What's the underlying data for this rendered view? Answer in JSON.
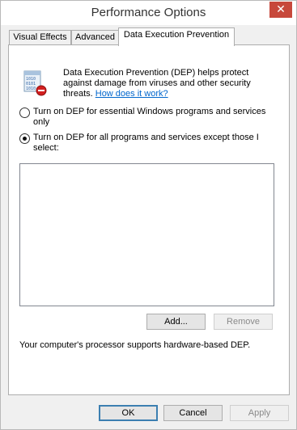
{
  "window": {
    "title": "Performance Options",
    "close_glyph": "✕"
  },
  "tabs": [
    {
      "label": "Visual Effects"
    },
    {
      "label": "Advanced"
    },
    {
      "label": "Data Execution Prevention"
    }
  ],
  "dep": {
    "icon": "dep-shield-icon",
    "description": "Data Execution Prevention (DEP) helps protect against damage from viruses and other security threats.",
    "link": "How does it work?",
    "option_essential": "Turn on DEP for essential Windows programs and services only",
    "option_all": "Turn on DEP for all programs and services except those I select:",
    "selected_option": "all",
    "add_label": "Add...",
    "remove_label": "Remove",
    "support_text": "Your computer's processor supports hardware-based DEP."
  },
  "footer": {
    "ok_label": "OK",
    "cancel_label": "Cancel",
    "apply_label": "Apply"
  }
}
